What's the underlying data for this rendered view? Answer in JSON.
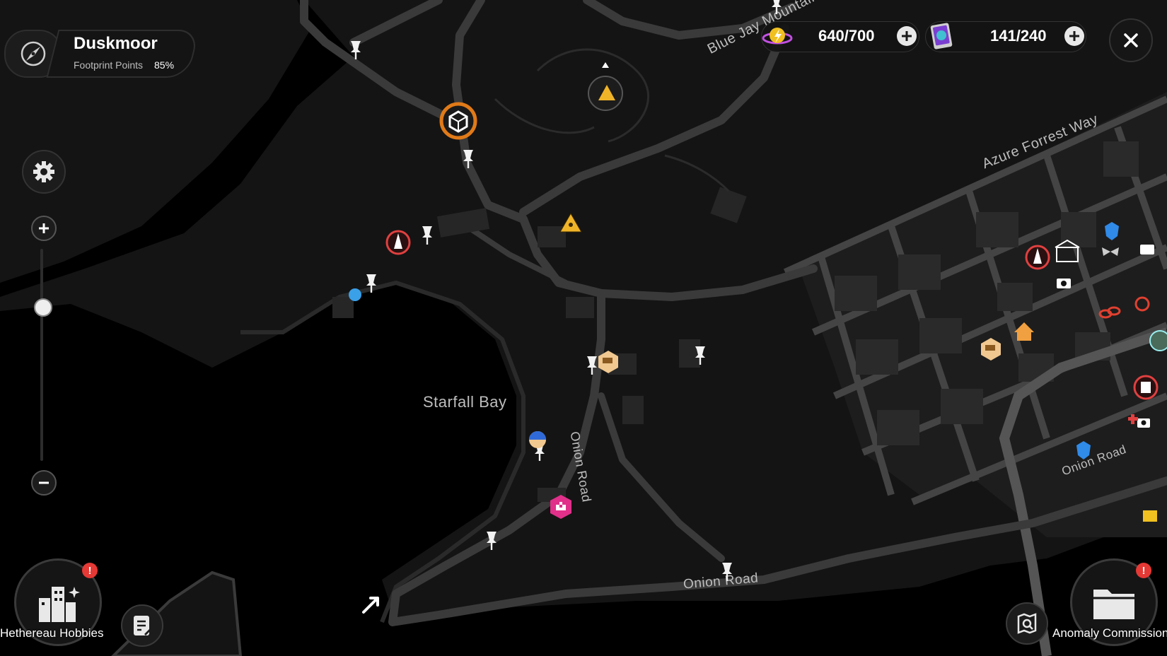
{
  "region": {
    "name": "Duskmoor",
    "footprint_label": "Footprint Points",
    "footprint_value": "85%"
  },
  "resources": {
    "energy": {
      "value": "640/700",
      "icon": "energy-orb-icon"
    },
    "cards": {
      "value": "141/240",
      "icon": "card-pack-icon"
    }
  },
  "map_labels": {
    "bay": "Starfall Bay",
    "road_azure": "Azure Forrest Way",
    "road_bluejay": "Blue Jay Mountain",
    "road_onion_v": "Onion Road",
    "road_onion_h": "Onion Road",
    "road_onion_r": "Onion Road"
  },
  "bottom": {
    "left_label": "Hethereau Hobbies",
    "right_label": "Anomaly Commission",
    "badge_mark": "!"
  },
  "zoom": {
    "level": 0.27
  },
  "colors": {
    "accent_orange": "#e07a18",
    "road": "#3a3a3a",
    "land": "#141414",
    "water": "#000000",
    "city_block": "#252525"
  }
}
